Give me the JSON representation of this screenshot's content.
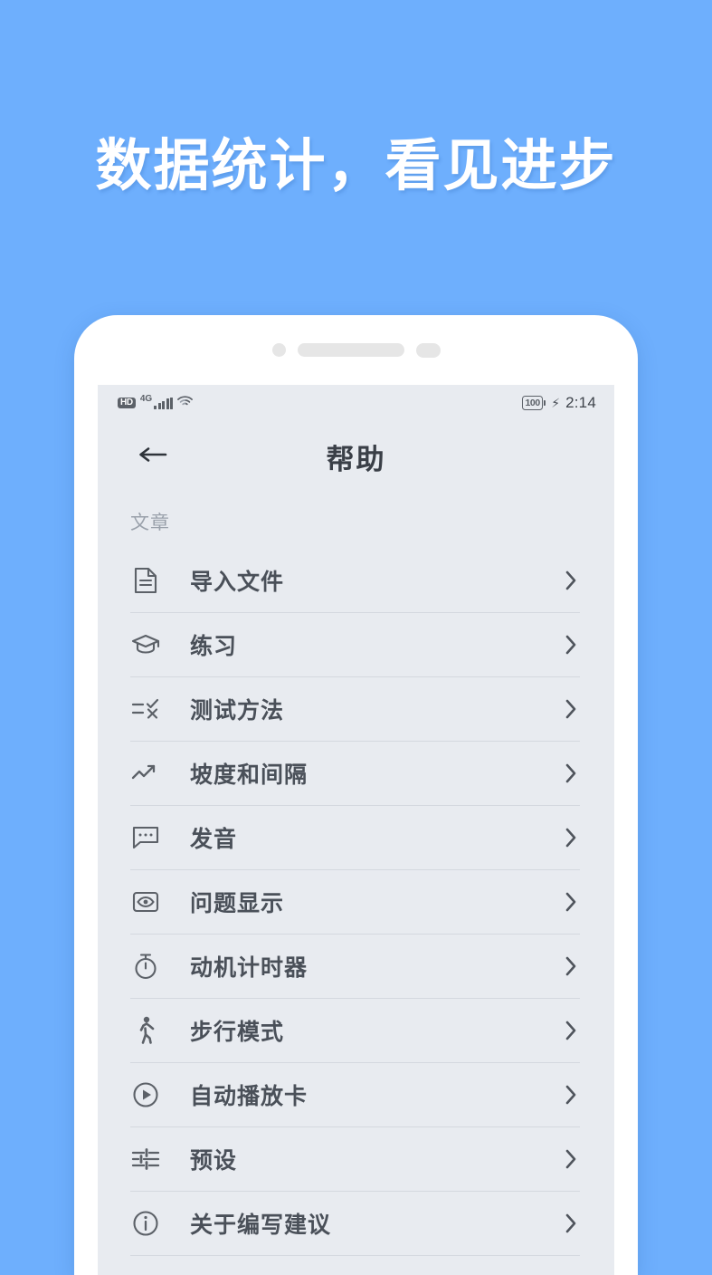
{
  "promo": {
    "headline": "数据统计，看见进步",
    "background_color": "#6eaffd",
    "text_color": "#ffffff"
  },
  "device": {
    "frame_color": "#ffffff",
    "screen_background": "#e8ebf0"
  },
  "status_bar": {
    "hd_label": "HD",
    "network_label": "4G",
    "signal_icon": "signal-bars-icon",
    "wifi_icon": "wifi-icon",
    "battery_level": "100",
    "charging_icon": "lightning-bolt-icon",
    "time": "2:14"
  },
  "nav": {
    "back_icon": "arrow-left-icon",
    "title": "帮助"
  },
  "content": {
    "section_title": "文章",
    "items": [
      {
        "label": "导入文件",
        "icon": "document-icon",
        "chevron": "chevron-right-icon"
      },
      {
        "label": "练习",
        "icon": "graduation-cap-icon",
        "chevron": "chevron-right-icon"
      },
      {
        "label": "测试方法",
        "icon": "check-x-list-icon",
        "chevron": "chevron-right-icon"
      },
      {
        "label": "坡度和间隔",
        "icon": "trending-up-icon",
        "chevron": "chevron-right-icon"
      },
      {
        "label": "发音",
        "icon": "chat-bubble-icon",
        "chevron": "chevron-right-icon"
      },
      {
        "label": "问题显示",
        "icon": "eye-frame-icon",
        "chevron": "chevron-right-icon"
      },
      {
        "label": "动机计时器",
        "icon": "stopwatch-icon",
        "chevron": "chevron-right-icon"
      },
      {
        "label": "步行模式",
        "icon": "walking-person-icon",
        "chevron": "chevron-right-icon"
      },
      {
        "label": "自动播放卡",
        "icon": "play-circle-icon",
        "chevron": "chevron-right-icon"
      },
      {
        "label": "预设",
        "icon": "tune-sliders-icon",
        "chevron": "chevron-right-icon"
      },
      {
        "label": "关于编写建议",
        "icon": "info-circle-icon",
        "chevron": "chevron-right-icon"
      }
    ]
  },
  "colors": {
    "accent_blue": "#6eaffd",
    "text_primary": "#4a5059",
    "text_secondary": "#9aa1ab",
    "divider": "#d4d8df"
  }
}
